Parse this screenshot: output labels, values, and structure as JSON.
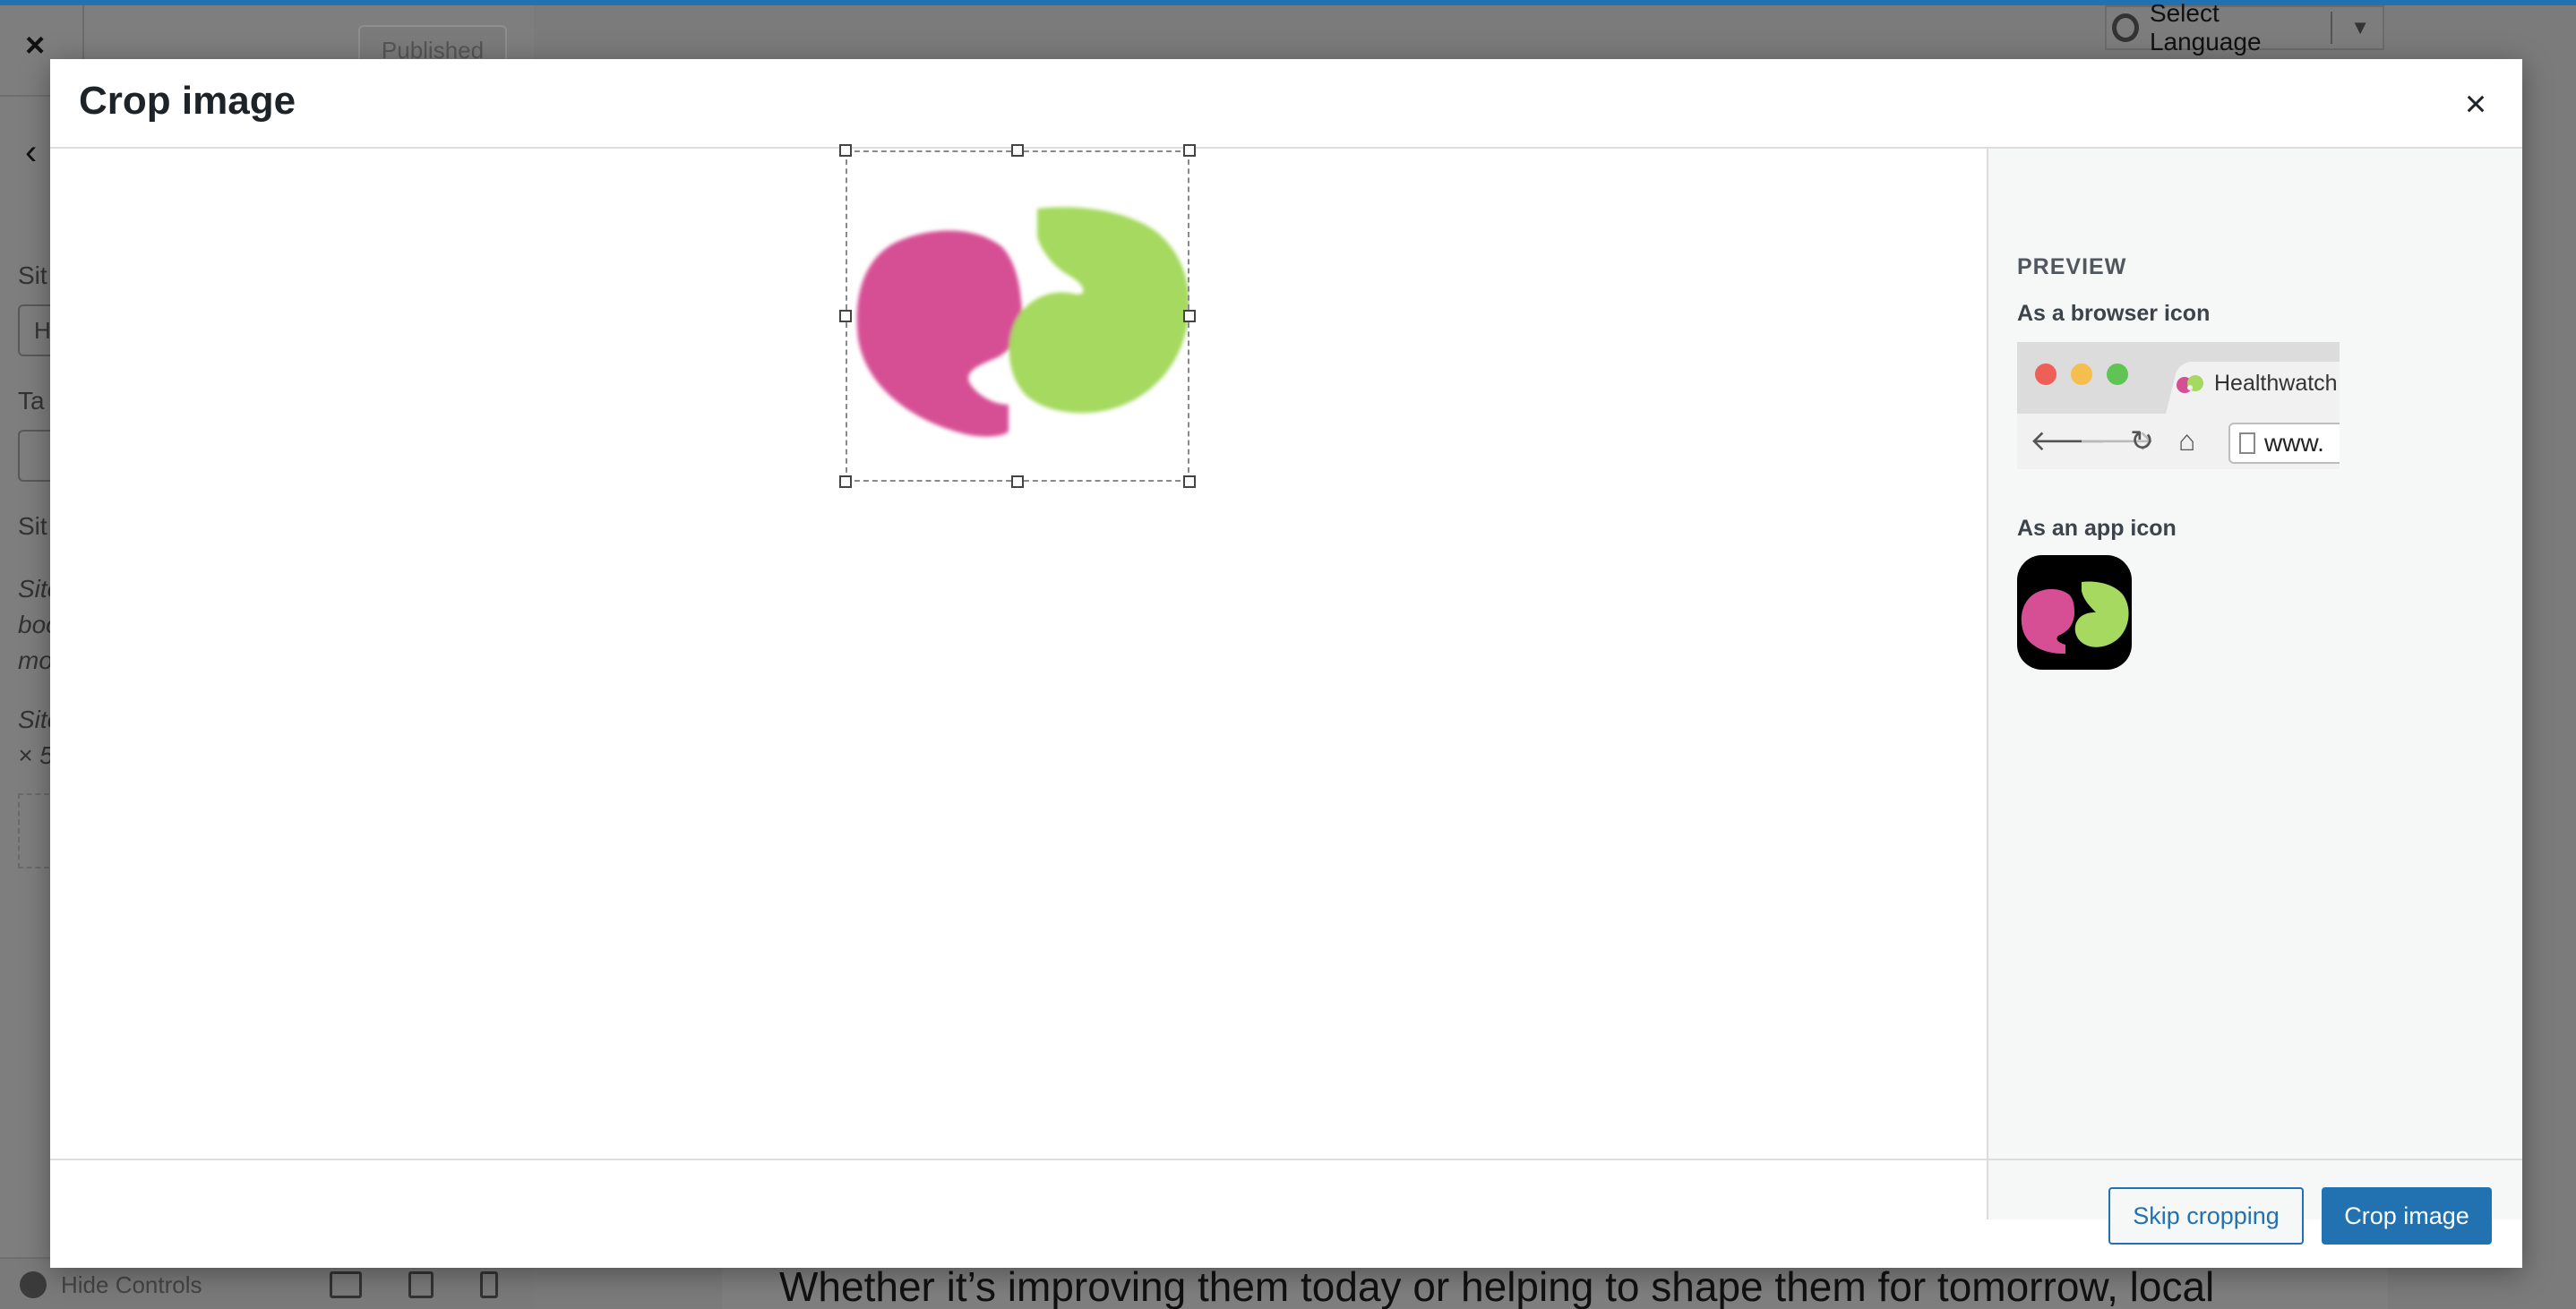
{
  "background": {
    "published_label": "Published",
    "language_label": "Select Language",
    "language_arrow": "▼",
    "close_glyph": "×",
    "back_glyph": "‹",
    "hide_controls_label": "Hide Controls",
    "tagline": "Whether it’s improving them today or helping to shape them for tomorrow, local",
    "sidebar_stubs": [
      "Sit",
      "Ta",
      "Sit",
      "Site",
      "boo",
      "mo",
      "Site",
      "× 5"
    ],
    "site_title_stub": "H"
  },
  "modal": {
    "title": "Crop image",
    "close_glyph": "×",
    "logo_colors": {
      "pink": "#d64f94",
      "green": "#a5d95f"
    }
  },
  "preview": {
    "heading": "PREVIEW",
    "browser_label": "As a browser icon",
    "tab_title": "Healthwatch",
    "url_text": "www.",
    "back_glyph": "🡐",
    "forward_glyph": "🡒",
    "reload_glyph": "↻",
    "home_glyph": "⌂",
    "app_label": "As an app icon",
    "traffic_light_colors": [
      "#ed5f57",
      "#f6be4f",
      "#5fc454"
    ]
  },
  "footer": {
    "skip_label": "Skip cropping",
    "crop_label": "Crop image"
  }
}
